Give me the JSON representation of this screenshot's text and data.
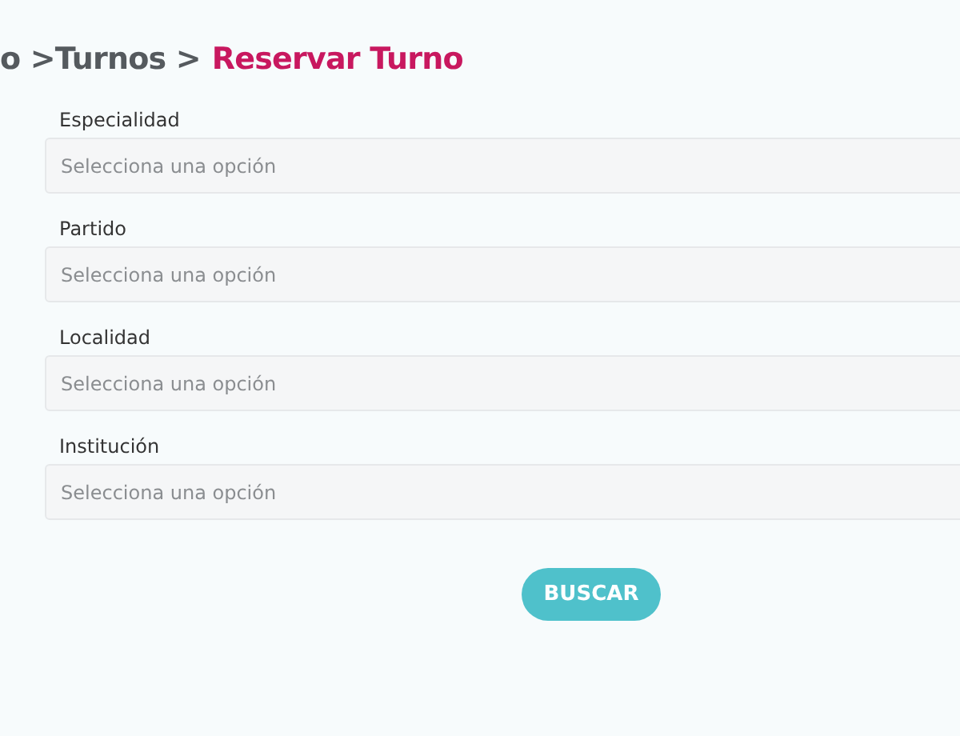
{
  "breadcrumb": [
    {
      "text": "o >Turnos >",
      "current": false
    },
    {
      "text": "Reservar Turno",
      "current": true
    }
  ],
  "fields": [
    {
      "label": "Especialidad",
      "placeholder": "Selecciona una opción"
    },
    {
      "label": "Partido",
      "placeholder": "Selecciona una opción"
    },
    {
      "label": "Localidad",
      "placeholder": "Selecciona una opción"
    },
    {
      "label": "Institución",
      "placeholder": "Selecciona una opción"
    }
  ],
  "button": "BUSCAR"
}
